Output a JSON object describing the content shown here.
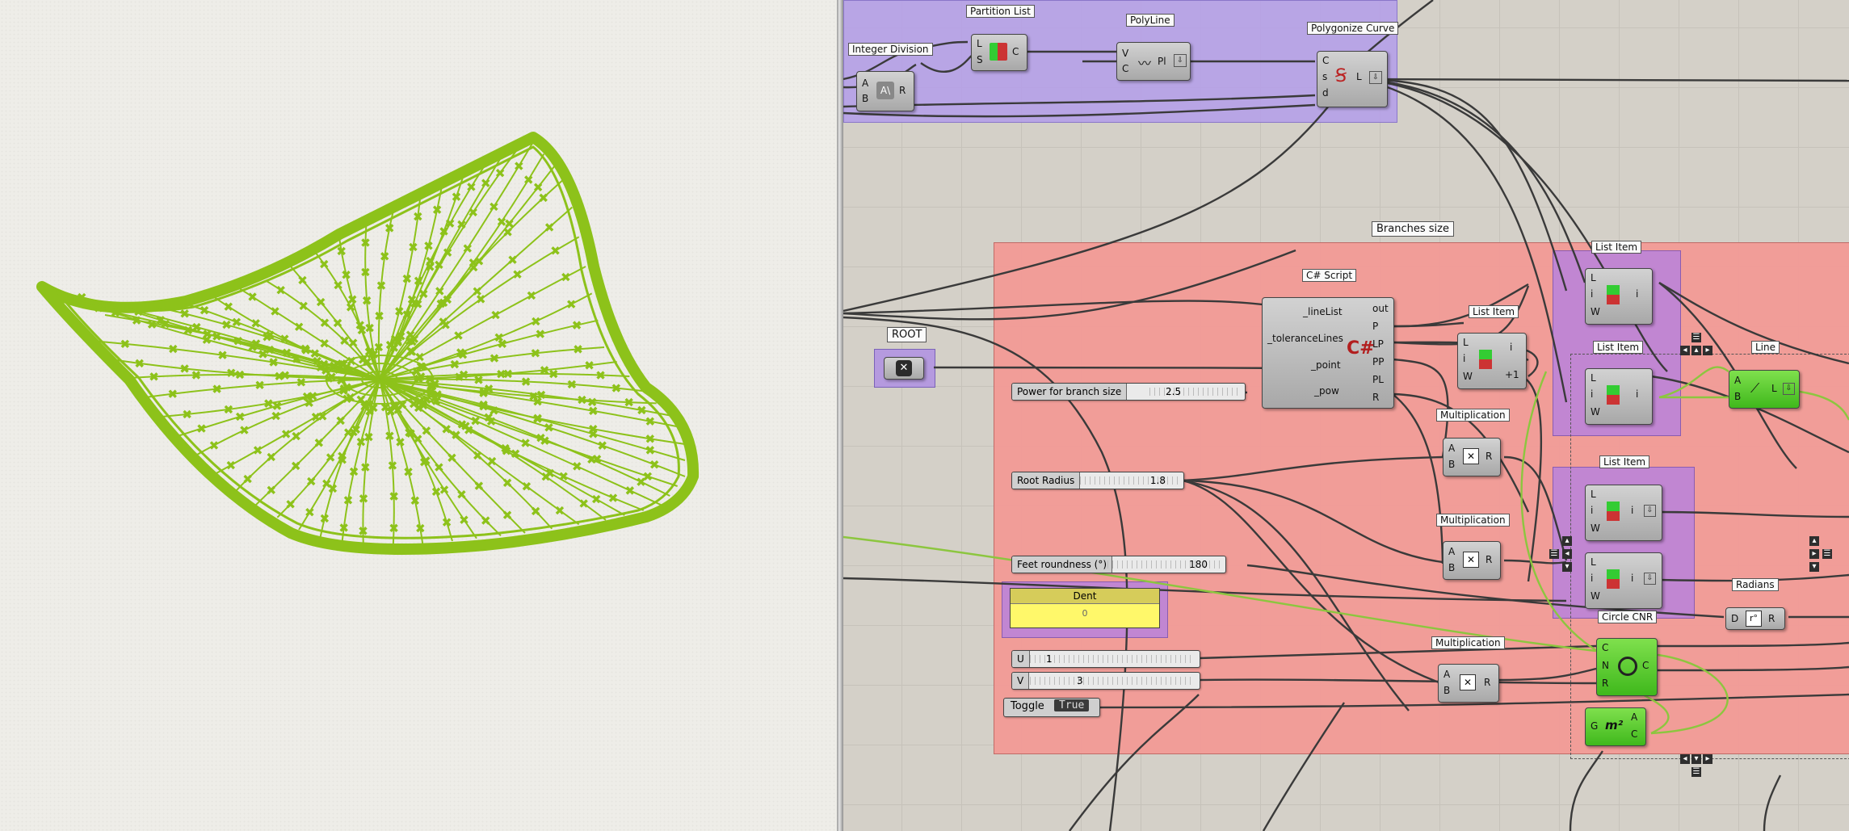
{
  "groups": {
    "branches_size": "Branches size",
    "root": "ROOT"
  },
  "components": {
    "integer_division": {
      "title": "Integer Division",
      "inputs": [
        "A",
        "B"
      ],
      "outputs": [
        "R"
      ]
    },
    "partition_list": {
      "title": "Partition List",
      "inputs": [
        "L",
        "S"
      ],
      "outputs": [
        "C"
      ]
    },
    "polyline": {
      "title": "PolyLine",
      "inputs": [
        "V",
        "C"
      ],
      "outputs": [
        "Pl"
      ]
    },
    "polygonize_curve": {
      "title": "Polygonize Curve",
      "inputs": [
        "C",
        "s",
        "d"
      ],
      "outputs": [
        "L"
      ]
    },
    "csharp_script": {
      "title": "C# Script",
      "inputs": [
        "_lineList",
        "_toleranceLines",
        "_point",
        "_pow"
      ],
      "outputs": [
        "out",
        "P",
        "LP",
        "PP",
        "PL",
        "R"
      ]
    },
    "list_item_1": {
      "title": "List Item",
      "inputs": [
        "L",
        "i",
        "W"
      ],
      "outputs": [
        "i"
      ]
    },
    "list_item_2": {
      "title": "List Item",
      "inputs": [
        "L",
        "i",
        "W"
      ],
      "outputs": [
        "i",
        "+1"
      ]
    },
    "list_item_3": {
      "title": "List Item",
      "inputs": [
        "L",
        "i",
        "W"
      ],
      "outputs": [
        "i"
      ]
    },
    "list_item_4": {
      "title": "List Item",
      "inputs": [
        "L",
        "i",
        "W"
      ],
      "outputs": [
        "i"
      ]
    },
    "list_item_5": {
      "inputs": [
        "L",
        "i",
        "W"
      ],
      "outputs": [
        "i"
      ]
    },
    "multiplication_1": {
      "title": "Multiplication",
      "inputs": [
        "A",
        "B"
      ],
      "outputs": [
        "R"
      ]
    },
    "multiplication_2": {
      "title": "Multiplication",
      "inputs": [
        "A",
        "B"
      ],
      "outputs": [
        "R"
      ]
    },
    "multiplication_3": {
      "title": "Multiplication",
      "inputs": [
        "A",
        "B"
      ],
      "outputs": [
        "R"
      ]
    },
    "line": {
      "title": "Line",
      "inputs": [
        "A",
        "B"
      ],
      "outputs": [
        "L"
      ]
    },
    "radians": {
      "title": "Radians",
      "inputs": [
        "D"
      ],
      "outputs": [
        "R"
      ]
    },
    "circle_cnr": {
      "title": "Circle CNR",
      "inputs": [
        "C",
        "N",
        "R"
      ],
      "outputs": [
        "C"
      ]
    },
    "area": {
      "inputs": [
        "G"
      ],
      "outputs": [
        "A",
        "C"
      ]
    }
  },
  "sliders": {
    "power": {
      "label": "Power for branch size",
      "value": "2.5"
    },
    "root_radius": {
      "label": "Root Radius",
      "value": "1.8"
    },
    "feet_roundness": {
      "label": "Feet roundness (°)",
      "value": "180"
    },
    "u": {
      "label": "U",
      "value": "1"
    },
    "v": {
      "label": "V",
      "value": "3"
    }
  },
  "panel": {
    "title": "Dent",
    "value": "0"
  },
  "toggle": {
    "label": "Toggle",
    "value": "True"
  },
  "colors": {
    "mesh_green": "#8dc21a",
    "group_purple": "#b5a0e8",
    "group_red": "#f29a96",
    "canvas": "#d4d0c8"
  },
  "icons": {
    "root_node": "hexagon-x-icon",
    "csharp": "csharp-icon",
    "multiply": "multiply-icon",
    "circle": "circle-icon",
    "line": "line-icon"
  }
}
